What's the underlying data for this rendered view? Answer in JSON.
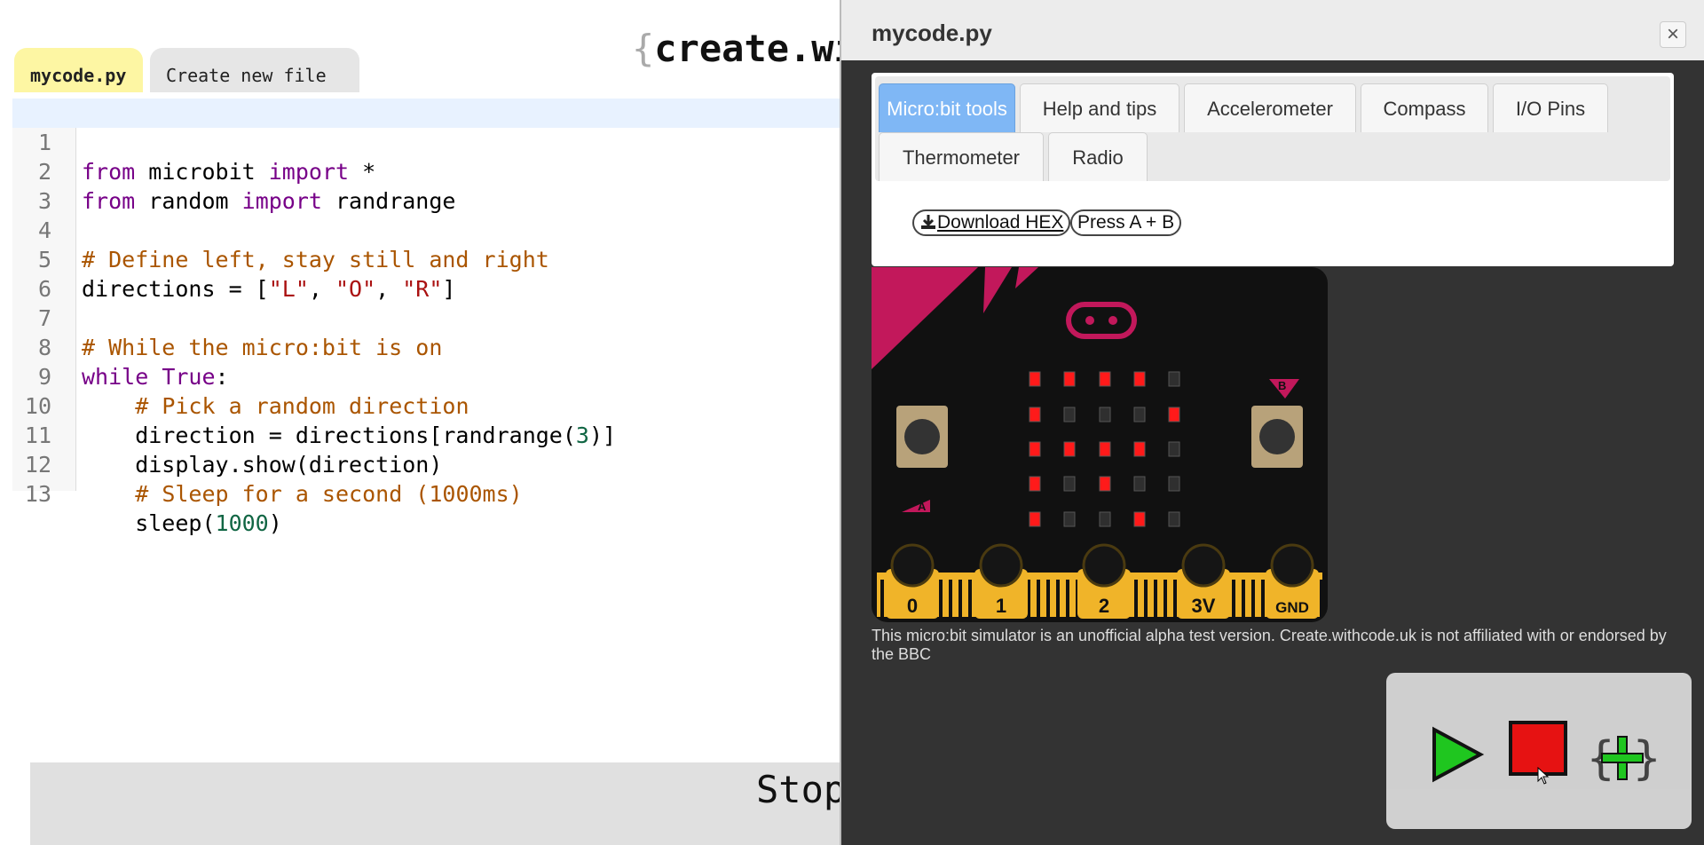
{
  "brand": {
    "brace": "{",
    "text": "create.wi"
  },
  "file_tabs": [
    {
      "label": "mycode.py",
      "active": true
    },
    {
      "label": "Create new file",
      "active": false
    }
  ],
  "code": {
    "lines": [
      {
        "n": "1",
        "current": true
      },
      {
        "n": "2"
      },
      {
        "n": "3"
      },
      {
        "n": "4"
      },
      {
        "n": "5"
      },
      {
        "n": "6"
      },
      {
        "n": "7"
      },
      {
        "n": "8"
      },
      {
        "n": "9"
      },
      {
        "n": "10"
      },
      {
        "n": "11"
      },
      {
        "n": "12"
      },
      {
        "n": "13"
      }
    ],
    "tokens": {
      "l1": [
        "from",
        " microbit ",
        "import",
        " *"
      ],
      "l2": [
        "from",
        " random ",
        "import",
        " randrange"
      ],
      "l4": [
        "# Define left, stay still and right"
      ],
      "l5": [
        "directions = [",
        "\"L\"",
        ", ",
        "\"O\"",
        ", ",
        "\"R\"",
        "]"
      ],
      "l7": [
        "# While the micro:bit is on"
      ],
      "l8": [
        "while",
        " ",
        "True",
        ":"
      ],
      "l9": [
        "    ",
        "# Pick a random direction"
      ],
      "l10": [
        "    direction = directions[randrange(",
        "3",
        ")]"
      ],
      "l11": [
        "    display.show(direction)"
      ],
      "l12": [
        "    ",
        "# Sleep for a second (1000ms)"
      ],
      "l13": [
        "    sleep(",
        "1000",
        ")"
      ]
    }
  },
  "stop_bar": {
    "label": "Stop running"
  },
  "simulator": {
    "title": "mycode.py",
    "close_glyph": "×",
    "tabs": [
      {
        "label": "Micro:bit tools",
        "active": true
      },
      {
        "label": "Help and tips"
      },
      {
        "label": "Accelerometer"
      },
      {
        "label": "Compass"
      },
      {
        "label": "I/O Pins"
      },
      {
        "label": "Thermometer"
      },
      {
        "label": "Radio"
      }
    ],
    "download_label": "Download HEX",
    "press_ab_label": "Press A + B",
    "button_a_label": "A",
    "button_b_label": "B",
    "pins": [
      "0",
      "1",
      "2",
      "3V",
      "GND"
    ],
    "led_matrix": [
      [
        1,
        1,
        1,
        1,
        0
      ],
      [
        1,
        0,
        0,
        0,
        1
      ],
      [
        1,
        1,
        1,
        1,
        0
      ],
      [
        1,
        0,
        1,
        0,
        0
      ],
      [
        1,
        0,
        0,
        1,
        0
      ]
    ],
    "disclaimer": "This micro:bit simulator is an unofficial alpha test version. Create.withcode.uk is not affiliated with or endorsed by the BBC",
    "colors": {
      "board": "#111111",
      "accent": "#c2185b",
      "pin": "#f0b429",
      "led_on": "#ff1a1a",
      "play": "#1fcc1f",
      "stop": "#ee1111"
    }
  }
}
